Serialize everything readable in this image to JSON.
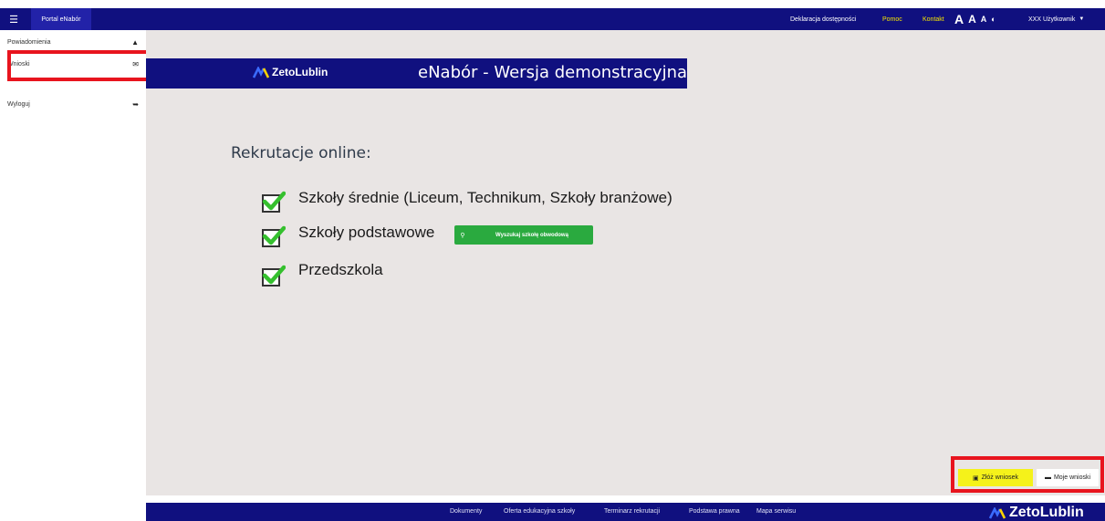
{
  "topbar": {
    "menu_icon": "hamburger-icon",
    "portal_label": "Portal eNabór",
    "dekl_label": "Deklaracja dostępności",
    "pomoc_label": "Pomoc",
    "kontakt_label": "Kontakt",
    "font_sizes": [
      "A",
      "A",
      "A"
    ],
    "contrast_icon": "contrast-icon",
    "user_label": "XXX Użytkownik",
    "colors": {
      "bar": "#10107f",
      "highlight_links": "#f5e400"
    }
  },
  "sidebar": {
    "items": [
      {
        "label": "Powiadomienia",
        "icon": "bell-icon"
      },
      {
        "label": "Wnioski",
        "icon": "envelope-icon"
      },
      {
        "label": "Wyloguj",
        "icon": "logout-icon"
      }
    ]
  },
  "banner": {
    "logo_text": "ZetoLublin",
    "title": "eNabór - Wersja demonstracyjna"
  },
  "main": {
    "section_title": "Rekrutacje online:",
    "items": [
      {
        "label": "Szkoły średnie (Liceum, Technikum, Szkoły branżowe)"
      },
      {
        "label": "Szkoły podstawowe"
      },
      {
        "label": "Przedszkola"
      }
    ],
    "search_button": {
      "label": "Wyszukaj szkołę obwodową",
      "icon": "search-icon"
    }
  },
  "actions": {
    "zloz_label": "Złóż wniosek",
    "zloz_icon": "document-icon",
    "moje_label": "Moje wnioski",
    "moje_icon": "folder-icon",
    "colors": {
      "zloz_bg": "#f5f21a",
      "highlight_border": "#e8141e"
    }
  },
  "footer": {
    "links": [
      "Dokumenty",
      "Oferta edukacyjna szkoły",
      "Terminarz rekrutacji",
      "Podstawa prawna",
      "Mapa serwisu"
    ],
    "logo_text": "ZetoLublin"
  }
}
